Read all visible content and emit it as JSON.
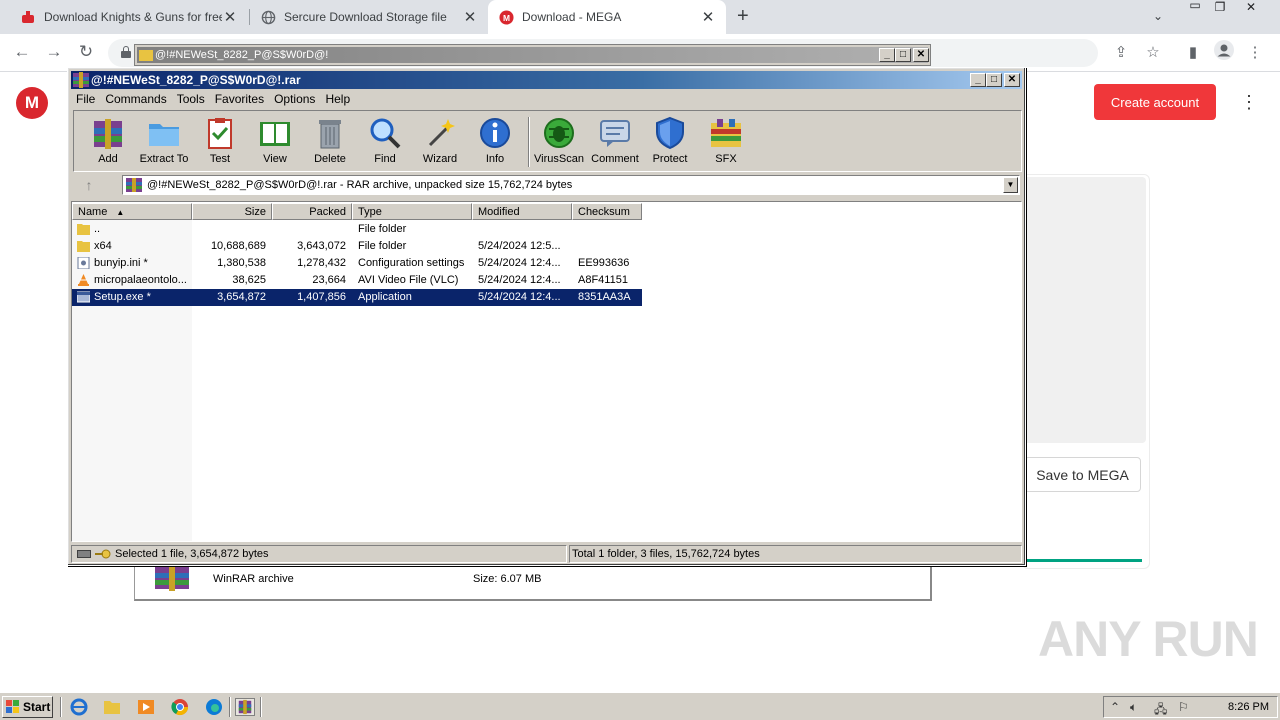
{
  "browser": {
    "tabs": [
      {
        "title": "Download Knights & Guns for free on",
        "icon": "download-icon",
        "accent": "#d9272e"
      },
      {
        "title": "Sercure Download Storage file",
        "icon": "globe-icon"
      },
      {
        "title": "Download - MEGA",
        "icon": "mega-icon",
        "accent": "#d9272e",
        "active": true
      }
    ]
  },
  "mega": {
    "logo": "M",
    "create_account": "Create account",
    "save_to_mega": "Save to MEGA",
    "file_type": "WinRAR archive",
    "file_size": "Size: 6.07 MB",
    "brand_color": "#d9272e",
    "button_color": "#f0373a"
  },
  "password_dialog": {
    "title": "@!#NEWeSt_8282_P@S$W0rD@!"
  },
  "winrar": {
    "title": "@!#NEWeSt_8282_P@S$W0rD@!.rar",
    "menu": [
      "File",
      "Commands",
      "Tools",
      "Favorites",
      "Options",
      "Help"
    ],
    "toolbar": [
      "Add",
      "Extract To",
      "Test",
      "View",
      "Delete",
      "Find",
      "Wizard",
      "Info",
      "VirusScan",
      "Comment",
      "Protect",
      "SFX"
    ],
    "address": "@!#NEWeSt_8282_P@S$W0rD@!.rar - RAR archive, unpacked size 15,762,724 bytes",
    "columns": [
      "Name",
      "Size",
      "Packed",
      "Type",
      "Modified",
      "Checksum"
    ],
    "rows": [
      {
        "name": "..",
        "size": "",
        "packed": "",
        "type": "File folder",
        "modified": "",
        "checksum": "",
        "icon": "folder-up-icon"
      },
      {
        "name": "x64",
        "size": "10,688,689",
        "packed": "3,643,072",
        "type": "File folder",
        "modified": "5/24/2024 12:5...",
        "checksum": "",
        "icon": "folder-icon"
      },
      {
        "name": "bunyip.ini *",
        "size": "1,380,538",
        "packed": "1,278,432",
        "type": "Configuration settings",
        "modified": "5/24/2024 12:4...",
        "checksum": "EE993636",
        "icon": "ini-file-icon"
      },
      {
        "name": "micropalaeontolo...",
        "size": "38,625",
        "packed": "23,664",
        "type": "AVI Video File (VLC)",
        "modified": "5/24/2024 12:4...",
        "checksum": "A8F41151",
        "icon": "vlc-icon"
      },
      {
        "name": "Setup.exe *",
        "size": "3,654,872",
        "packed": "1,407,856",
        "type": "Application",
        "modified": "5/24/2024 12:4...",
        "checksum": "8351AA3A",
        "icon": "exe-icon",
        "selected": true
      }
    ],
    "status_left": "Selected 1 file, 3,654,872 bytes",
    "status_right": "Total 1 folder, 3 files, 15,762,724 bytes",
    "selection_color": "#0a246a"
  },
  "taskbar": {
    "start": "Start",
    "clock": "8:26 PM"
  },
  "watermark": "ANY RUN"
}
